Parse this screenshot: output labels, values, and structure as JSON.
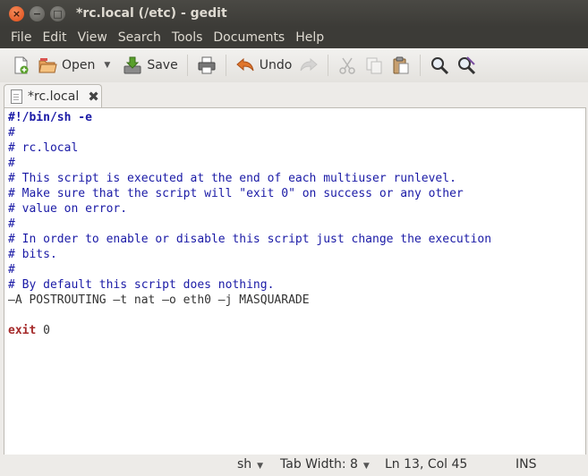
{
  "window": {
    "title": "*rc.local (/etc) - gedit",
    "close_glyph": "×",
    "min_glyph": "−",
    "max_glyph": "□"
  },
  "menu": [
    "File",
    "Edit",
    "View",
    "Search",
    "Tools",
    "Documents",
    "Help"
  ],
  "toolbar": {
    "open_label": "Open",
    "save_label": "Save",
    "undo_label": "Undo"
  },
  "tab": {
    "label": "*rc.local",
    "close_glyph": "✖"
  },
  "editor": {
    "lines": [
      {
        "text": "#!/bin/sh -e",
        "style": "shebang"
      },
      {
        "text": "#",
        "style": "comment"
      },
      {
        "text": "# rc.local",
        "style": "comment"
      },
      {
        "text": "#",
        "style": "comment"
      },
      {
        "text": "# This script is executed at the end of each multiuser runlevel.",
        "style": "comment"
      },
      {
        "text": "# Make sure that the script will \"exit 0\" on success or any other",
        "style": "comment"
      },
      {
        "text": "# value on error.",
        "style": "comment"
      },
      {
        "text": "#",
        "style": "comment"
      },
      {
        "text": "# In order to enable or disable this script just change the execution",
        "style": "comment"
      },
      {
        "text": "# bits.",
        "style": "comment"
      },
      {
        "text": "#",
        "style": "comment"
      },
      {
        "text": "# By default this script does nothing.",
        "style": "comment"
      },
      {
        "text": "—A POSTROUTING —t nat —o eth0 —j MASQUARADE",
        "style": "plain"
      },
      {
        "text": "",
        "style": "plain"
      },
      {
        "kw": "exit",
        "rest": " 0",
        "style": "exit"
      }
    ]
  },
  "status": {
    "language": "sh",
    "tab_width": "Tab Width: 8",
    "position": "Ln 13, Col 45",
    "mode": "INS"
  },
  "colors": {
    "titlebar": "#3c3b37",
    "close_button": "#df4a16",
    "comment": "#1a1aa6",
    "keyword": "#a52a2a"
  }
}
